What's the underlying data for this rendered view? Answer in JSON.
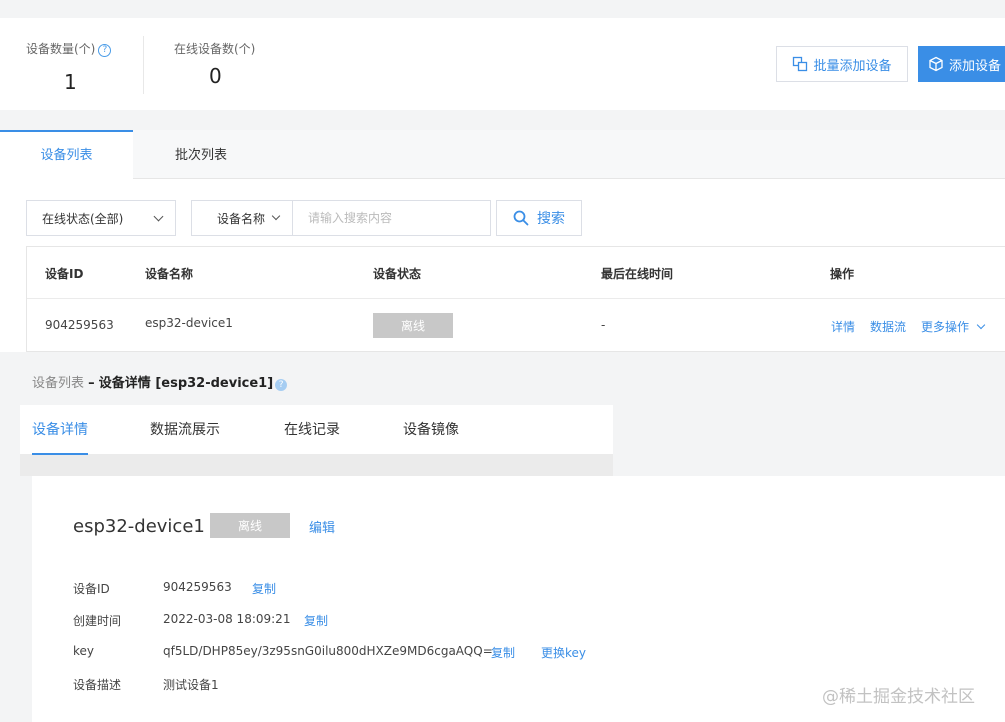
{
  "stats": {
    "device_count_label": "设备数量(个)",
    "device_count_help": "?",
    "device_count_value": "1",
    "online_count_label": "在线设备数(个)",
    "online_count_value": "0"
  },
  "actions": {
    "batch_add_label": "批量添加设备",
    "add_label": "添加设备"
  },
  "list_tabs": [
    "设备列表",
    "批次列表"
  ],
  "filters": {
    "status_select": "在线状态(全部)",
    "search_field_select": "设备名称",
    "search_placeholder": "请输入搜索内容",
    "search_button": "搜索"
  },
  "table": {
    "columns": [
      "设备ID",
      "设备名称",
      "设备状态",
      "最后在线时间",
      "操作"
    ],
    "rows": [
      {
        "id": "904259563",
        "name": "esp32-device1",
        "status": "离线",
        "last_online": "-",
        "ops": [
          "详情",
          "数据流",
          "更多操作"
        ]
      }
    ]
  },
  "breadcrumb": {
    "root": "设备列表",
    "sep": "–",
    "current": "设备详情 [esp32-device1]",
    "help": "?"
  },
  "detail_tabs": [
    "设备详情",
    "数据流展示",
    "在线记录",
    "设备镜像"
  ],
  "detail": {
    "title": "esp32-device1",
    "status": "离线",
    "edit_label": "编辑",
    "fields": [
      {
        "key": "设备ID",
        "value": "904259563",
        "links": [
          "复制"
        ]
      },
      {
        "key": "创建时间",
        "value": "2022-03-08 18:09:21",
        "links": [
          "复制"
        ]
      },
      {
        "key": "key",
        "value": "qf5LD/DHP85ey/3z95snG0ilu800dHXZe9MD6cgaAQQ=",
        "links": [
          "复制",
          "更换key"
        ]
      },
      {
        "key": "设备描述",
        "value": "测试设备1",
        "links": []
      }
    ]
  },
  "watermark": "@稀土掘金技术社区",
  "colors": {
    "accent": "#3a8ee6",
    "offline_badge": "#c8c8c8"
  }
}
